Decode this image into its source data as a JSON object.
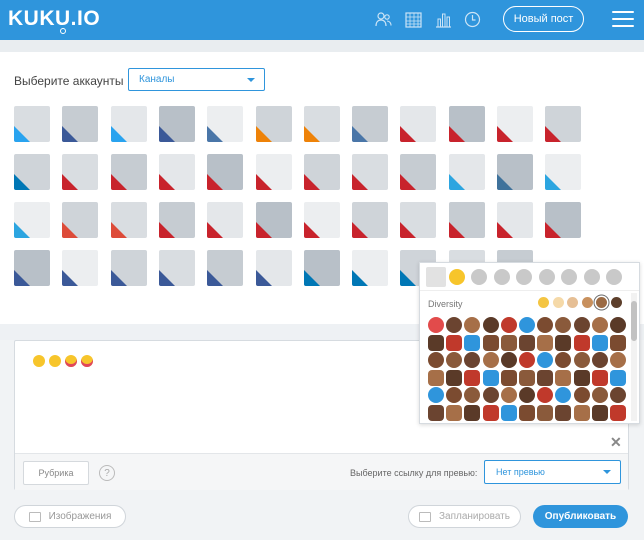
{
  "header": {
    "logo": "KUKU.IO",
    "new_post_label": "Новый пост",
    "icons": [
      "users-icon",
      "calendar-grid-icon",
      "stats-icon",
      "clock-icon",
      "menu-icon"
    ]
  },
  "accounts": {
    "label": "Выберите аккаунты",
    "select_value": "Каналы"
  },
  "editor": {
    "typed_emojis": "😀😄😜😛",
    "rubric_label": "Рубрика",
    "help_label": "?",
    "preview_label": "Выберите ссылку для превью:",
    "preview_value": "Нет превью"
  },
  "emoji_picker": {
    "tabs": [
      "clock-icon",
      "smiley-icon",
      "animal-icon",
      "food-icon",
      "ball-icon",
      "travel-icon",
      "bulb-icon",
      "heart-icon",
      "flag-icon"
    ],
    "diversity_label": "Diversity",
    "skin_tones": [
      "#f4c542",
      "#f5d9a8",
      "#e6bf95",
      "#c8905d",
      "#9b6a43",
      "#5d3f2b"
    ],
    "close_label": "✕"
  },
  "buttons": {
    "images": "Изображения",
    "schedule": "Запланировать",
    "publish": "Опубликовать"
  },
  "colors": {
    "brand": "#2f95dc",
    "twitter": "#29a3ef",
    "facebook": "#3b5998",
    "vk": "#4a76a8",
    "pinterest": "#c8232c",
    "gplus": "#dd4b39",
    "linkedin": "#0077b5",
    "telegram": "#2ca5e0",
    "instagram": "#3f729b",
    "ok": "#ee8208"
  }
}
